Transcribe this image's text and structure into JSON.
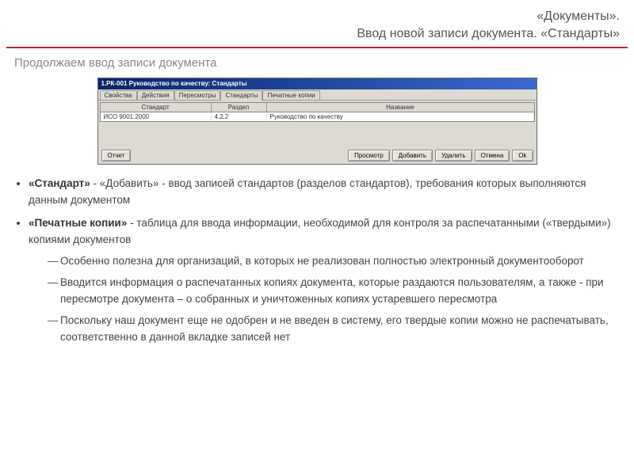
{
  "header": {
    "line1": "«Документы».",
    "line2": "Ввод новой записи документа. «Стандарты»"
  },
  "subheading": "Продолжаем ввод записи документа",
  "app": {
    "title": "1.РК-001 Руководство по качеству: Стандарты",
    "tabs": {
      "t1": "Свойства",
      "t2": "Действия",
      "t3": "Пересмотры",
      "t4": "Стандарты",
      "t5": "Печатные копии"
    },
    "columns": {
      "c1": "Стандарт",
      "c2": "Раздел",
      "c3": "Название"
    },
    "row": {
      "std": "ИСО 9001:2000",
      "sec": "4.2.2",
      "name": "Руководство по качеству"
    },
    "buttons": {
      "report": "Отчет",
      "view": "Просмотр",
      "add": "Добавить",
      "delete": "Удалить",
      "cancel": "Отмена",
      "ok": "Ok"
    }
  },
  "content": {
    "b1_label": "«Стандарт»",
    "b1_rest": " - «Добавить» - ввод записей стандартов (разделов стандартов), требования которых выполняются данным документом",
    "b2_label": "«Печатные копии»",
    "b2_rest": " - таблица для ввода информации, необходимой для контроля за распечатанными («твердыми») копиями документов",
    "sub1": "Особенно полезна для организаций, в которых не реализован полностью электронный документооборот",
    "sub2": "Вводится информация о распечатанных копиях документа, которые раздаются пользователям, а также  - при пересмотре документа – о собранных и уничтоженных копиях устаревшего пересмотра",
    "sub3": "Поскольку наш документ еще не одобрен и не введен в систему, его твердые копии можно не распечатывать, соответственно в данной вкладке записей нет"
  }
}
